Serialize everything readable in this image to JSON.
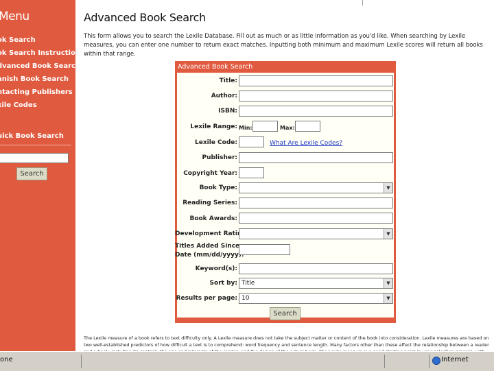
{
  "sidebar": {
    "title": "Menu",
    "items": [
      {
        "label": "ok Search"
      },
      {
        "label": "ok Search Instructions"
      },
      {
        "label": "dvanced Book Search"
      },
      {
        "label": "anish Book Search"
      },
      {
        "label": "ntacting Publishers"
      },
      {
        "label": "xile Codes"
      }
    ],
    "quick_search": {
      "title": "uick Book Search",
      "input_value": "",
      "button_label": "Search"
    }
  },
  "main": {
    "title": "Advanced Book Search",
    "intro": "This form allows you to search the Lexile Database. Fill out as much or as little information as you'd like. When searching by Lexile measures, you can enter one number to return exact matches. Inputting both minimum and maximum Lexile scores will return all books within that range.",
    "footer": "The Lexile measure of a book refers to text difficulty only. A Lexile measure does not take the subject matter or content of the book into consideration. Lexile measures are based on two well-established predictors of how difficult a text is to comprehend: word frequency and sentence length. Many factors other than these affect the relationship between a reader and a book, including its content, the age and interests of the reader, and the design of the actual book. The Lexile measure is a good starting point in your selection process, with these other"
  },
  "form": {
    "header": "Advanced Book Search",
    "labels": {
      "title": "Title:",
      "author": "Author:",
      "isbn": "ISBN:",
      "lexile_range": "Lexile Range:",
      "min": "Min:",
      "max": "Max:",
      "lexile_code": "Lexile Code:",
      "lexile_code_link": "What Are Lexile Codes?",
      "publisher": "Publisher:",
      "copyright_year": "Copyright Year:",
      "book_type": "Book Type:",
      "reading_series": "Reading Series:",
      "book_awards": "Book Awards:",
      "development_rating": "Development Rating:",
      "titles_added_1": "Titles Added Since",
      "titles_added_2": "Date (mm/dd/yyyy):",
      "keywords": "Keyword(s):",
      "sort_by": "Sort by:",
      "results_per_page": "Results per page:"
    },
    "values": {
      "book_type": "",
      "development_rating": "",
      "sort_by": "Title",
      "results_per_page": "10"
    },
    "search_button": "Search"
  },
  "statusbar": {
    "status": "one",
    "zone": "Internet"
  }
}
